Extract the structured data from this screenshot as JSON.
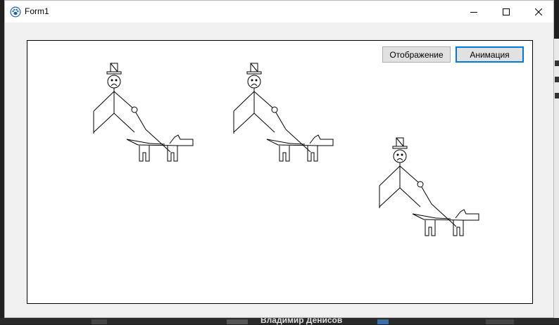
{
  "window": {
    "title": "Form1",
    "app_icon": "paw-icon"
  },
  "buttons": {
    "display_label": "Отображение",
    "animation_label": "Анимация"
  },
  "background": {
    "taskbar_text": "Владимир Денисов"
  },
  "icons": [
    "minimize-icon",
    "maximize-icon",
    "close-icon"
  ]
}
